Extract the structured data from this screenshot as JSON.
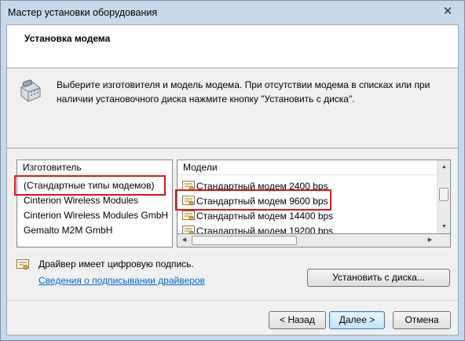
{
  "window": {
    "title": "Мастер установки оборудования",
    "close_glyph": "✕"
  },
  "header": {
    "heading": "Установка модема"
  },
  "intro": {
    "text": "Выберите изготовителя и модель модема. При отсутствии модема в списках или при наличии установочного диска нажмите кнопку \"Установить с диска\"."
  },
  "manufacturers": {
    "header": "Изготовитель",
    "items": [
      {
        "label": "(Стандартные типы модемов)"
      },
      {
        "label": "Cinterion Wireless Modules"
      },
      {
        "label": "Cinterion Wireless Modules GmbH"
      },
      {
        "label": "Gemalto M2M GmbH"
      }
    ],
    "selected_index": 0
  },
  "models": {
    "header": "Модели",
    "items": [
      {
        "label": "Стандартный модем  2400 bps"
      },
      {
        "label": "Стандартный модем  9600 bps"
      },
      {
        "label": "Стандартный модем 14400 bps"
      },
      {
        "label": "Стандартный модем 19200 bps"
      }
    ],
    "selected_index": 1,
    "item_icon": "certificate-icon"
  },
  "signature": {
    "status": "Драйвер имеет цифровую подпись.",
    "link": "Сведения о подписывании драйверов",
    "icon": "signed-driver-icon"
  },
  "buttons": {
    "install_from_disk": "Установить с диска...",
    "back": "< Назад",
    "next": "Далее >",
    "cancel": "Отмена"
  },
  "colors": {
    "highlight": "#e0131e",
    "link": "#0066cc"
  }
}
